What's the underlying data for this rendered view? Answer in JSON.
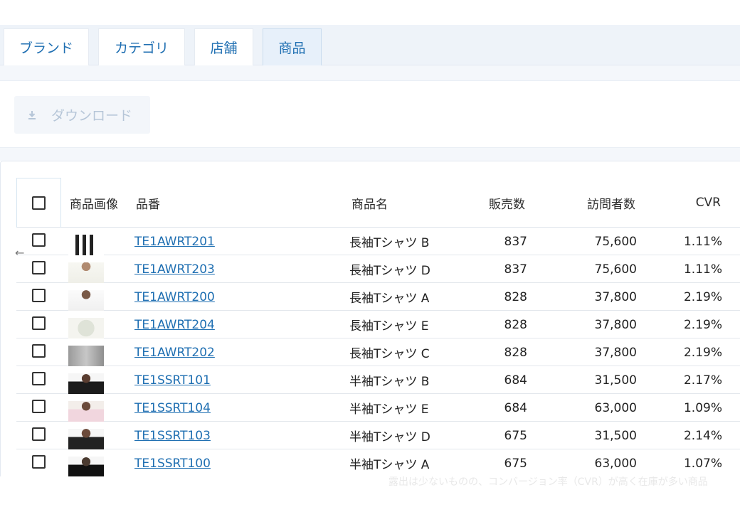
{
  "tabs": [
    {
      "label": "ブランド",
      "active": false
    },
    {
      "label": "カテゴリ",
      "active": false
    },
    {
      "label": "店舗",
      "active": false
    },
    {
      "label": "商品",
      "active": true
    }
  ],
  "toolbar": {
    "download_label": "ダウンロード",
    "download_icon": "download-icon"
  },
  "table": {
    "headers": {
      "image": "商品画像",
      "code": "品番",
      "name": "商品名",
      "sales": "販売数",
      "visitors": "訪問者数",
      "cvr": "CVR"
    },
    "rows": [
      {
        "code": "TE1AWRT201",
        "name": "長袖Tシャツ B",
        "sales": "837",
        "visitors": "75,600",
        "cvr": "1.11%"
      },
      {
        "code": "TE1AWRT203",
        "name": "長袖Tシャツ D",
        "sales": "837",
        "visitors": "75,600",
        "cvr": "1.11%"
      },
      {
        "code": "TE1AWRT200",
        "name": "長袖Tシャツ A",
        "sales": "828",
        "visitors": "37,800",
        "cvr": "2.19%"
      },
      {
        "code": "TE1AWRT204",
        "name": "長袖Tシャツ E",
        "sales": "828",
        "visitors": "37,800",
        "cvr": "2.19%"
      },
      {
        "code": "TE1AWRT202",
        "name": "長袖Tシャツ C",
        "sales": "828",
        "visitors": "37,800",
        "cvr": "2.19%"
      },
      {
        "code": "TE1SSRT101",
        "name": "半袖Tシャツ B",
        "sales": "684",
        "visitors": "31,500",
        "cvr": "2.17%"
      },
      {
        "code": "TE1SSRT104",
        "name": "半袖Tシャツ E",
        "sales": "684",
        "visitors": "63,000",
        "cvr": "1.09%"
      },
      {
        "code": "TE1SSRT103",
        "name": "半袖Tシャツ D",
        "sales": "675",
        "visitors": "31,500",
        "cvr": "2.14%"
      },
      {
        "code": "TE1SSRT100",
        "name": "半袖Tシャツ A",
        "sales": "675",
        "visitors": "63,000",
        "cvr": "1.07%"
      }
    ]
  },
  "back_arrow": "←",
  "footer_note": "露出は少ないものの、コンバージョン率（CVR）が高く在庫が多い商品",
  "colors": {
    "accent": "#1f6fb2",
    "tab_active_bg": "#e7f0fa",
    "band_bg": "#eef3f9"
  }
}
